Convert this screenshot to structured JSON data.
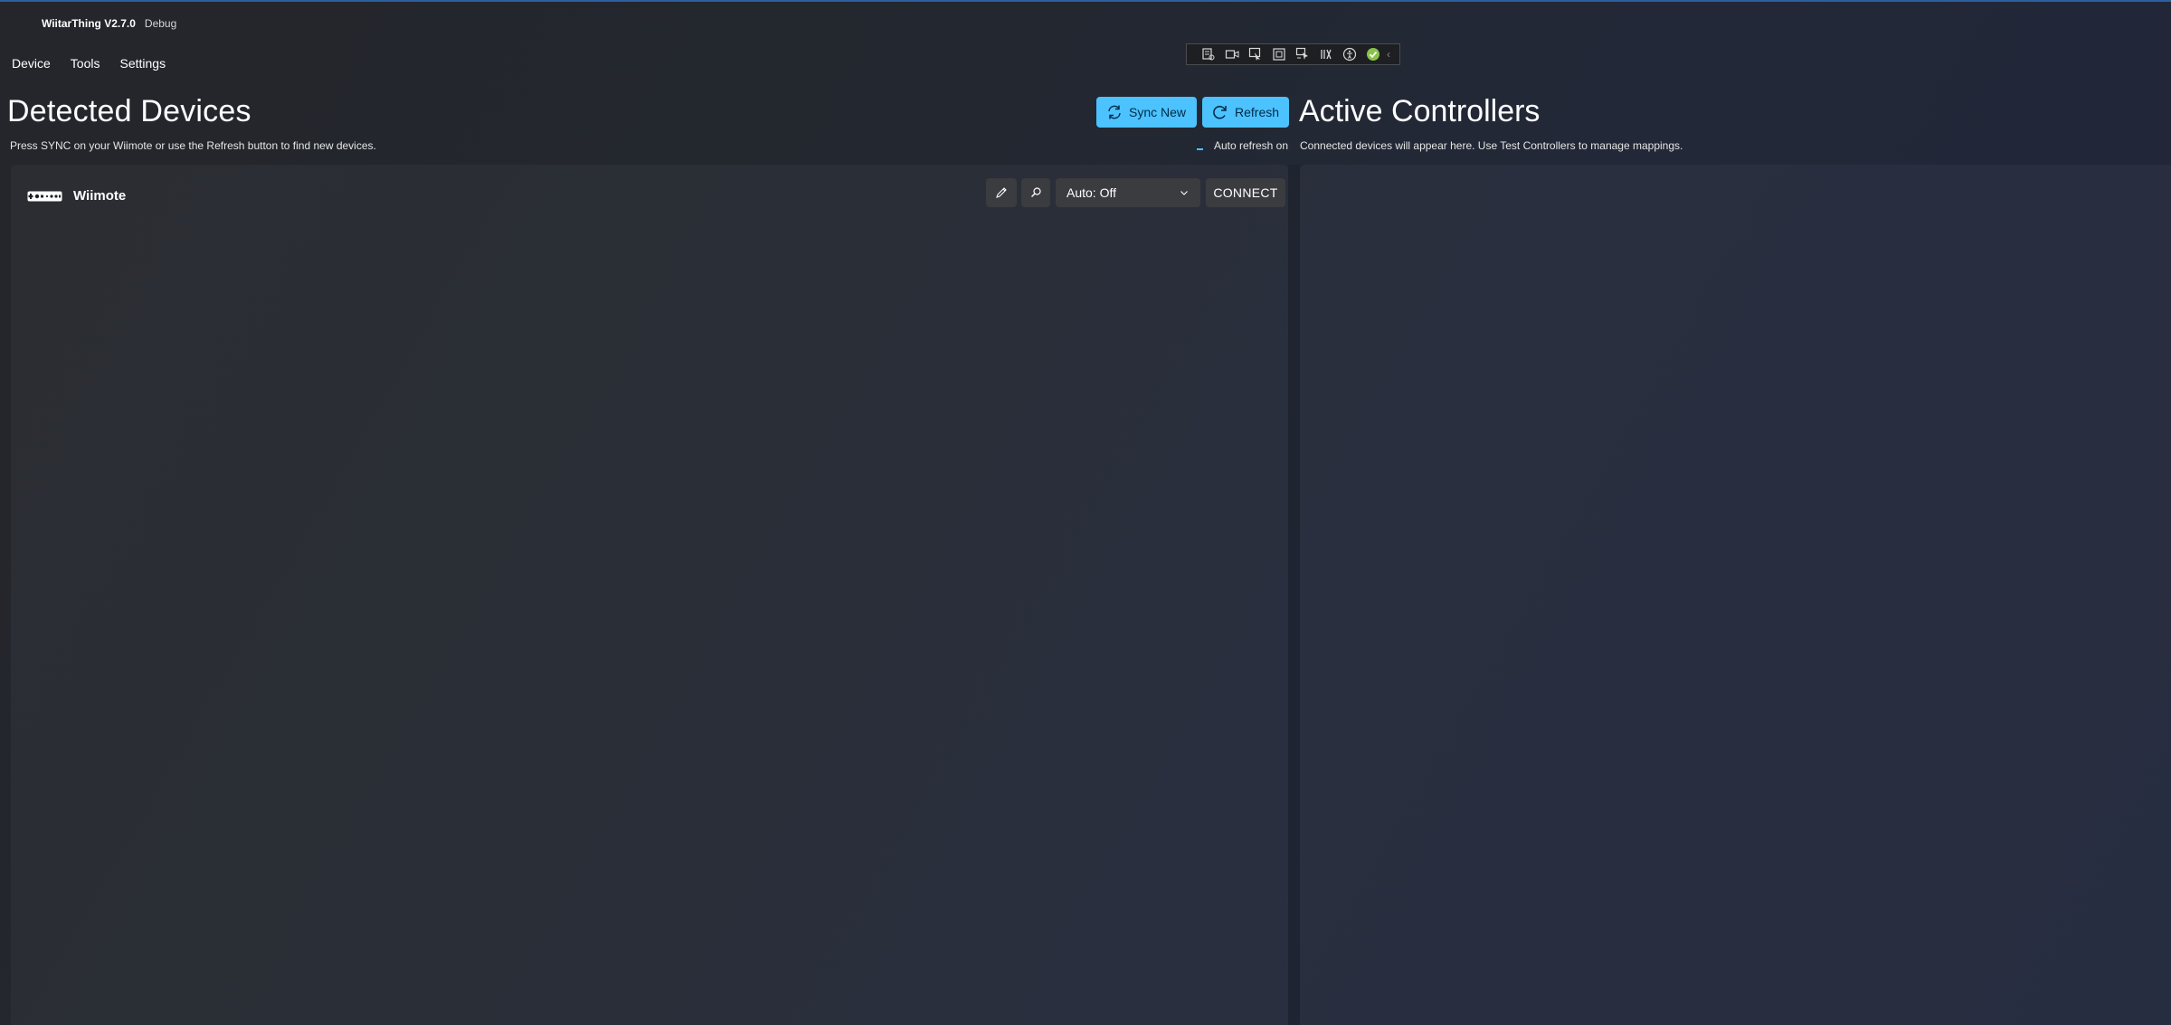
{
  "window": {
    "title": "WiitarThing V2.7.0",
    "mode": "Debug"
  },
  "menu": {
    "items": [
      "Device",
      "Tools",
      "Settings"
    ]
  },
  "debug_toolbar": {
    "icons": [
      "live-visual-tree-icon",
      "video-icon",
      "select-element-icon",
      "display-layout-adorners-icon",
      "track-focused-element-icon",
      "binding-failures-icon",
      "accessibility-icon",
      "checkmark-icon",
      "collapse-chevron-icon"
    ],
    "collapse_glyph": "‹"
  },
  "detected": {
    "title": "Detected Devices",
    "subtitle": "Press SYNC on your Wiimote or use the Refresh button to find new devices.",
    "sync_label": "Sync New",
    "refresh_label": "Refresh",
    "auto_refresh_label": "Auto refresh on"
  },
  "devices": [
    {
      "name": "Wiimote",
      "auto_mode": "Auto: Off",
      "connect_label": "CONNECT"
    }
  ],
  "active": {
    "title": "Active Controllers",
    "subtitle": "Connected devices will appear here. Use Test Controllers to manage mappings."
  },
  "colors": {
    "accent": "#4cc2ff",
    "control_bg": "#3a3c40",
    "window_border": "#2b5f9e",
    "check_green": "#8bc34a"
  }
}
